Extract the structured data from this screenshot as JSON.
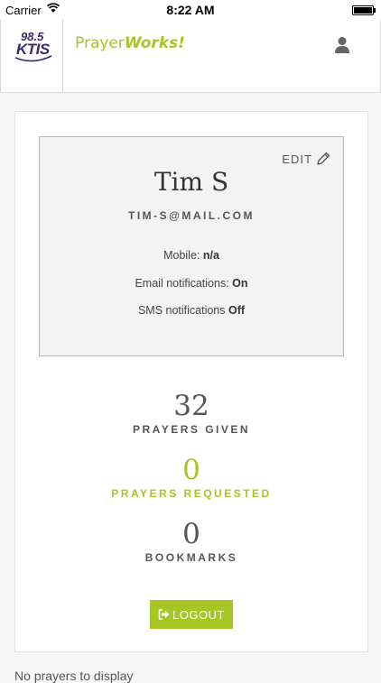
{
  "status_bar": {
    "carrier": "Carrier",
    "time": "8:22 AM"
  },
  "header": {
    "ktis_number": "98.5",
    "ktis_letters": "KTIS",
    "brand_part1": "Prayer",
    "brand_part2": "Works!",
    "user_icon": "user-icon"
  },
  "profile": {
    "edit_label": "EDIT",
    "name": "Tim S",
    "email": "TIM-S@MAIL.COM",
    "mobile_label": "Mobile:",
    "mobile_value": "n/a",
    "email_notif_label": "Email notifications:",
    "email_notif_value": "On",
    "sms_notif_label": "SMS notifications",
    "sms_notif_value": "Off"
  },
  "stats": {
    "given_count": "32",
    "given_label": "PRAYERS GIVEN",
    "requested_count": "0",
    "requested_label": "PRAYERS REQUESTED",
    "bookmarks_count": "0",
    "bookmarks_label": "BOOKMARKS"
  },
  "logout_label": "LOGOUT",
  "footer_text": "No prayers to display",
  "colors": {
    "accent": "#a8c526",
    "ktis_purple": "#3b2a6b",
    "text": "#555555"
  }
}
